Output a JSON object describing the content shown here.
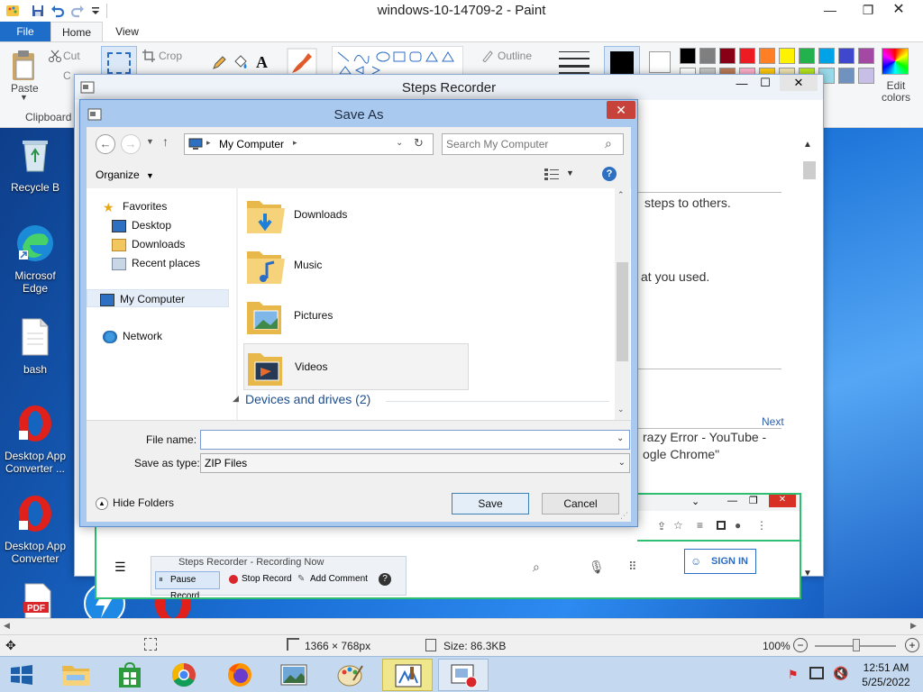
{
  "paint": {
    "title": "windows-10-14709-2 - Paint",
    "tabs": {
      "file": "File",
      "home": "Home",
      "view": "View"
    },
    "ribbon": {
      "paste": "Paste",
      "cut": "Cut",
      "copy": "C",
      "clipboard": "Clipboard",
      "crop": "Crop",
      "outline": "Outline",
      "edit_colors": "Edit colors",
      "text_tool": "A"
    },
    "palette": [
      "#000000",
      "#7f7f7f",
      "#880015",
      "#ed1c24",
      "#ff7f27",
      "#fff200",
      "#22b14c",
      "#00a2e8",
      "#3f48cc",
      "#a349a4",
      "#ffffff",
      "#c3c3c3",
      "#b97a57",
      "#ffaec9",
      "#ffc90e",
      "#efe4b0",
      "#b5e61d",
      "#99d9ea",
      "#7092be",
      "#c8bfe7"
    ],
    "status": {
      "dimensions": "1366 × 768px",
      "size": "Size: 86.3KB",
      "zoom": "100%"
    },
    "desktop_icons": [
      {
        "label": "Recycle B"
      },
      {
        "label": "Microsof Edge"
      },
      {
        "label": "bash"
      },
      {
        "label": "Desktop App Converter ..."
      },
      {
        "label": "Desktop App Converter"
      }
    ]
  },
  "steps_recorder": {
    "title": "Steps Recorder",
    "text_1": "steps to others.",
    "text_2": "at you used.",
    "next_link": "Next",
    "text_3": "razy Error - YouTube -",
    "text_4": "ogle Chrome\"",
    "sign_in": "SIGN IN",
    "recording_title": "Steps Recorder - Recording Now",
    "pause_record": "Pause Record",
    "stop_record": "Stop Record",
    "add_comment": "Add Comment"
  },
  "save_as": {
    "title": "Save As",
    "address": "My Computer",
    "search_placeholder": "Search My Computer",
    "organize": "Organize",
    "nav": {
      "favorites": "Favorites",
      "desktop": "Desktop",
      "downloads": "Downloads",
      "recent_places": "Recent places",
      "my_computer": "My Computer",
      "network": "Network"
    },
    "folders": [
      "Downloads",
      "Music",
      "Pictures",
      "Videos"
    ],
    "devices_group": "Devices and drives (2)",
    "file_name_label": "File name:",
    "file_name_value": "",
    "save_type_label": "Save as type:",
    "save_type_value": "ZIP Files",
    "hide_folders": "Hide Folders",
    "save_button": "Save",
    "cancel_button": "Cancel"
  },
  "taskbar": {
    "time": "12:51 AM",
    "date": "5/25/2022"
  }
}
